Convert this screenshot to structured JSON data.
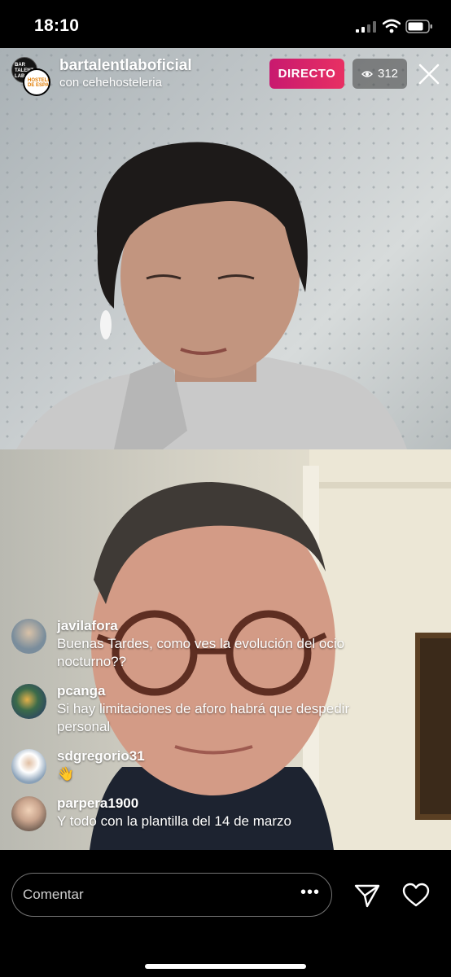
{
  "status": {
    "time": "18:10"
  },
  "live": {
    "host": "bartalentlaboficial",
    "with": "con cehehosteleria",
    "badge": "DIRECTO",
    "viewers": "312",
    "host_avatar_text": "BAR TALENT LAB",
    "guest_avatar_text": "HOSTELERÍA DE ESPAÑA"
  },
  "comments": [
    {
      "user": "javilafora",
      "text": "Buenas Tardes, como ves la evolución del ocio nocturno??",
      "avatar_color": "#7a8d9c"
    },
    {
      "user": "pcanga",
      "text": "Si hay limitaciones de aforo habrá que despedir personal",
      "avatar_color": "#2f4a5f"
    },
    {
      "user": "sdgregorio31",
      "text": "👋",
      "avatar_color": "#8aa1b8"
    },
    {
      "user": "parpera1900",
      "text": "Y todo con la plantilla del 14 de marzo",
      "avatar_color": "#9b8a7c"
    }
  ],
  "input": {
    "placeholder": "Comentar",
    "more": "•••"
  },
  "icons": {
    "send": "send-icon",
    "heart": "heart-icon",
    "close": "close-icon",
    "eye": "eye-icon"
  },
  "colors": {
    "live_badge": "#d81b6a",
    "background": "#000000"
  }
}
